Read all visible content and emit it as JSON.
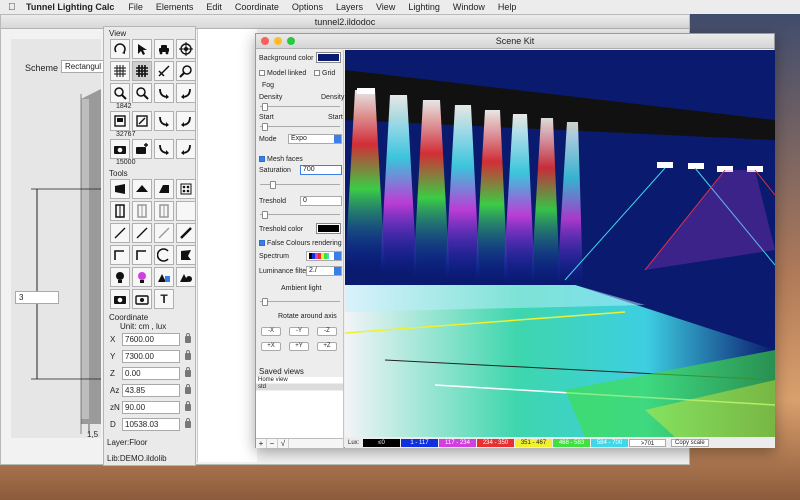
{
  "menubar": {
    "app_name": "Tunnel Lighting Calc",
    "items": [
      "File",
      "Elements",
      "Edit",
      "Coordinate",
      "Options",
      "Layers",
      "View",
      "Lighting",
      "Window",
      "Help"
    ]
  },
  "document": {
    "title": "tunnel2.ildodoc",
    "scheme_label": "Scheme",
    "scheme_value": "Rectangul",
    "dimension_value": "3",
    "dimension_bottom": "1,5"
  },
  "palette": {
    "view_label": "View",
    "tools_label": "Tools",
    "view_numbers": [
      "1842",
      "32767",
      "15000"
    ],
    "text_tool_glyph": "T",
    "coordinate_title": "Coordinate",
    "unit_label": "Unit:  cm , lux",
    "coords": [
      {
        "label": "X",
        "value": "7600.00"
      },
      {
        "label": "Y",
        "value": "7300.00"
      },
      {
        "label": "Z",
        "value": "0.00"
      },
      {
        "label": "Az",
        "value": "43.85"
      },
      {
        "label": "zN",
        "value": "90.00"
      },
      {
        "label": "D",
        "value": "10538.03"
      }
    ],
    "layer_label": "Layer:Floor",
    "lib_label": "Lib:DEMO.ildolib"
  },
  "scene": {
    "title": "Scene Kit",
    "background_color_label": "Background color",
    "model_linked_label": "Model linked",
    "grid_label": "Grid",
    "fog_label": "Fog",
    "density_left": "Density",
    "density_right": "Density",
    "start_left": "Start",
    "start_right": "Start",
    "mode_label": "Mode",
    "mode_value": "Expo",
    "mesh_faces_label": "Mesh faces",
    "saturation_label": "Saturation",
    "saturation_value": "700",
    "treshold_label": "Treshold",
    "treshold_value": "0",
    "treshold_color_label": "Treshold color",
    "false_colours_label": "False Colours rendering",
    "spectrum_label": "Spectrum",
    "luminance_filter_label": "Luminance filter",
    "luminance_filter_value": "2./",
    "ambient_light_label": "Ambient light",
    "rotate_label": "Rotate around axis",
    "rotate_buttons": [
      "-X",
      "-Y",
      "-Z",
      "+X",
      "+Y",
      "+Z"
    ],
    "saved_views_label": "Saved views",
    "saved_views": [
      "Home view",
      "std"
    ],
    "bottom_buttons": [
      "+",
      "−",
      "√"
    ],
    "background_color": "#0a1a6e"
  },
  "legend": {
    "lux_label": "Lux:",
    "bins": [
      {
        "label": "≤0",
        "color": "#000000",
        "text_color": "#ffffff"
      },
      {
        "label": "1 - 117",
        "color": "#1030e0",
        "text_color": "#ffffff"
      },
      {
        "label": "117 - 234",
        "color": "#d040e0",
        "text_color": "#ffffff"
      },
      {
        "label": "234 - 350",
        "color": "#e83030",
        "text_color": "#ffffff"
      },
      {
        "label": "351 - 467",
        "color": "#f0f030",
        "text_color": "#222222"
      },
      {
        "label": "468 - 583",
        "color": "#40e040",
        "text_color": "#ffffff"
      },
      {
        "label": "584 - 700",
        "color": "#40d8e8",
        "text_color": "#ffffff"
      },
      {
        "label": ">701",
        "color": "#ffffff",
        "text_color": "#222222"
      }
    ],
    "copy_scale_label": "Copy scale"
  }
}
